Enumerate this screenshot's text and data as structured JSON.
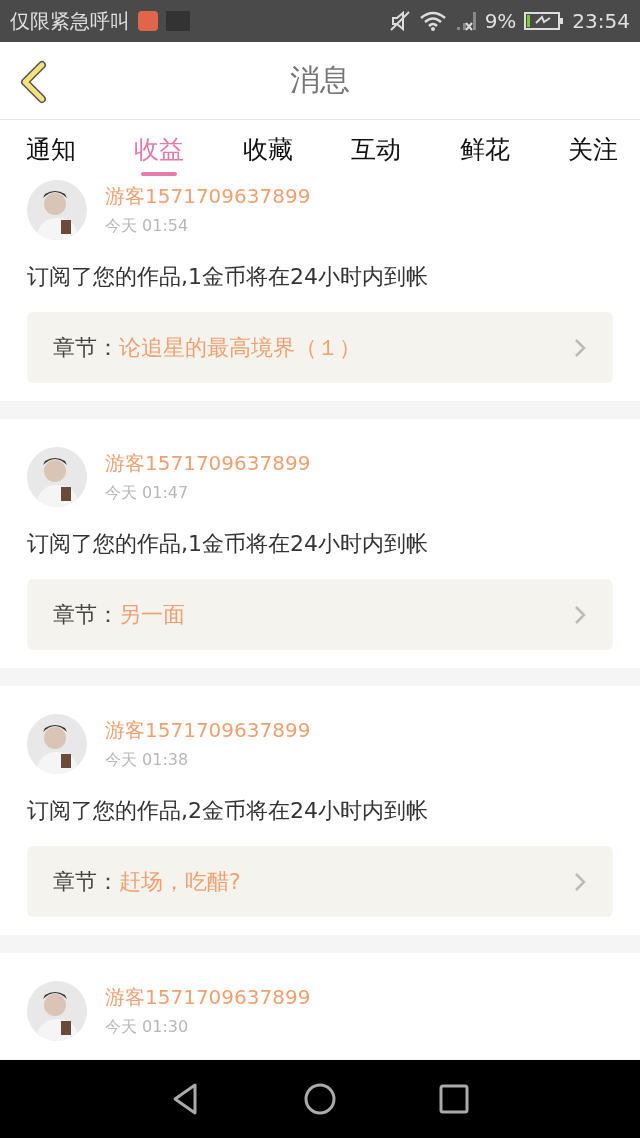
{
  "status_bar": {
    "carrier": "仅限紧急呼叫",
    "battery": "9%",
    "time": "23:54"
  },
  "header": {
    "title": "消息"
  },
  "tabs": [
    {
      "label": "通知",
      "selected": false
    },
    {
      "label": "收益",
      "selected": true
    },
    {
      "label": "收藏",
      "selected": false
    },
    {
      "label": "互动",
      "selected": false
    },
    {
      "label": "鲜花",
      "selected": false
    },
    {
      "label": "关注",
      "selected": false
    }
  ],
  "messages": [
    {
      "user": "游客1571709637899",
      "time": "今天 01:54",
      "text": "订阅了您的作品,1金币将在24小时内到帐",
      "chapter_label": "章节：",
      "chapter": "论追星的最高境界（１）"
    },
    {
      "user": "游客1571709637899",
      "time": "今天 01:47",
      "text": "订阅了您的作品,1金币将在24小时内到帐",
      "chapter_label": "章节：",
      "chapter": "另一面"
    },
    {
      "user": "游客1571709637899",
      "time": "今天 01:38",
      "text": "订阅了您的作品,2金币将在24小时内到帐",
      "chapter_label": "章节：",
      "chapter": "赶场，吃醋?"
    },
    {
      "user": "游客1571709637899",
      "time": "今天 01:30"
    }
  ]
}
